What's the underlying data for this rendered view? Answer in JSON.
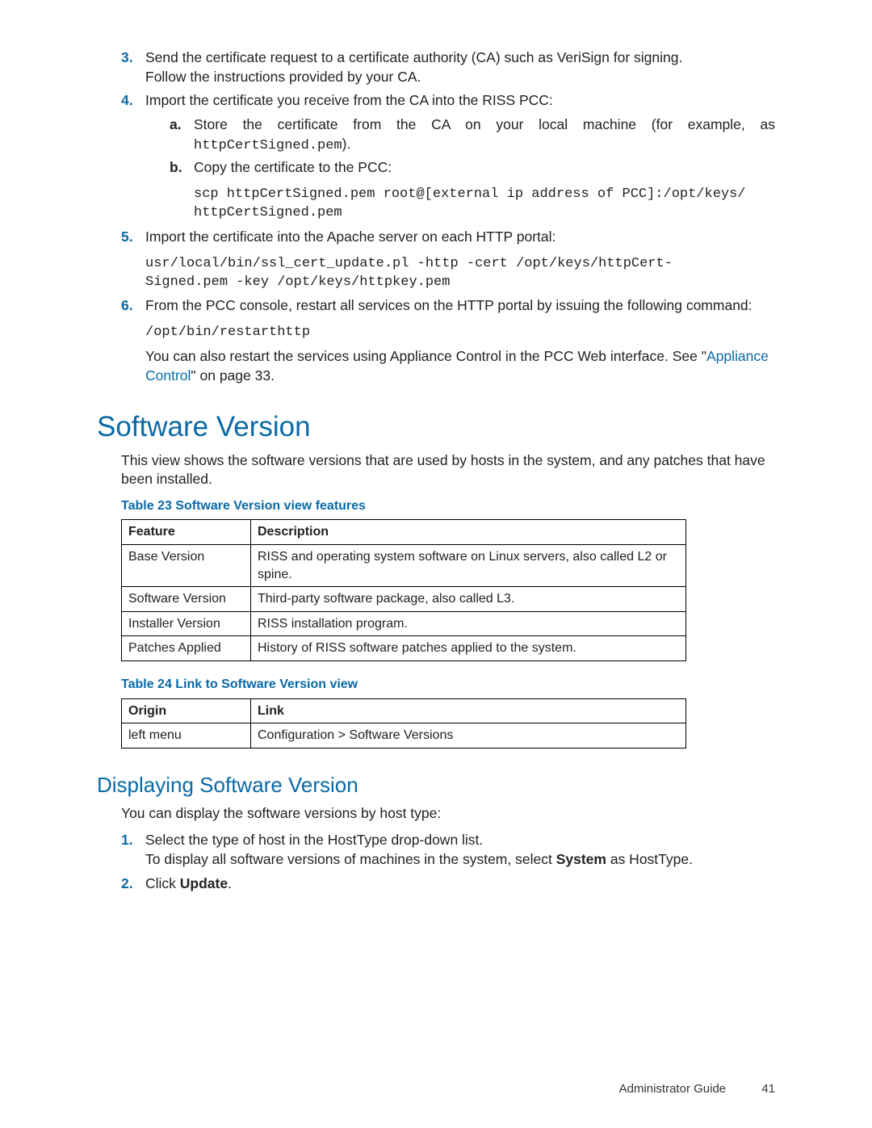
{
  "steps": {
    "s3": {
      "num": "3.",
      "line1": "Send the certificate request to a certificate authority (CA) such as VeriSign for signing.",
      "line2": "Follow the instructions provided by your CA."
    },
    "s4": {
      "num": "4.",
      "text": "Import the certificate you receive from the CA into the RISS PCC:",
      "a": {
        "num": "a.",
        "text_pre": "Store the certificate from the CA on your local machine (for example, as ",
        "code": "httpCertSigned.pem",
        "text_post": ")."
      },
      "b": {
        "num": "b.",
        "text": "Copy the certificate to the PCC:",
        "code": "scp httpCertSigned.pem root@[external ip address of PCC]:/opt/keys/\nhttpCertSigned.pem"
      }
    },
    "s5": {
      "num": "5.",
      "text": "Import the certificate into the Apache server on each HTTP portal:",
      "code": "usr/local/bin/ssl_cert_update.pl -http -cert /opt/keys/httpCert-\nSigned.pem -key /opt/keys/httpkey.pem"
    },
    "s6": {
      "num": "6.",
      "text": "From the PCC console, restart all services on the HTTP portal by issuing the following command:",
      "code": "/opt/bin/restarthttp",
      "after_pre": "You can also restart the services using Appliance Control in the PCC Web interface. See \"",
      "link": "Appliance Control",
      "after_post": "\" on page 33."
    }
  },
  "section1": {
    "title": "Software Version",
    "intro": "This view shows the software versions that are used by hosts in the system, and any patches that have been installed."
  },
  "table23": {
    "caption": "Table 23 Software Version view features",
    "head": {
      "c1": "Feature",
      "c2": "Description"
    },
    "rows": [
      {
        "c1": "Base Version",
        "c2": "RISS and operating system software on Linux servers, also called L2 or spine."
      },
      {
        "c1": "Software Version",
        "c2": "Third-party software package, also called L3."
      },
      {
        "c1": "Installer Version",
        "c2": "RISS installation program."
      },
      {
        "c1": "Patches Applied",
        "c2": "History of RISS software patches applied to the system."
      }
    ]
  },
  "table24": {
    "caption": "Table 24 Link to Software Version view",
    "head": {
      "c1": "Origin",
      "c2": "Link"
    },
    "rows": [
      {
        "c1": "left menu",
        "c2": "Configuration > Software Versions"
      }
    ]
  },
  "section2": {
    "title": "Displaying Software Version",
    "intro": "You can display the software versions by host type:",
    "s1": {
      "num": "1.",
      "line1": "Select the type of host in the HostType drop-down list.",
      "line2_pre": "To display all software versions of machines in the system, select ",
      "line2_bold": "System",
      "line2_post": " as HostType."
    },
    "s2": {
      "num": "2.",
      "pre": "Click ",
      "bold": "Update",
      "post": "."
    }
  },
  "footer": {
    "title": "Administrator Guide",
    "page": "41"
  }
}
